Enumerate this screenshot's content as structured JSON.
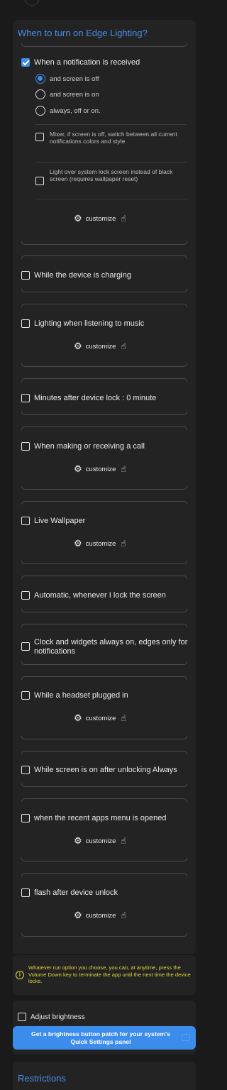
{
  "header": {
    "title": "When to turn on Edge Lighting?"
  },
  "notification": {
    "label": "When a notification is received",
    "checked": true,
    "options": [
      {
        "label": "and screen is off",
        "selected": true
      },
      {
        "label": "and screen is on",
        "selected": false
      },
      {
        "label": "always, off or on.",
        "selected": false
      }
    ],
    "mixer_label": "Mixer, if screen is off, switch between all current notifications colors and style",
    "lockscreen_label": "Light over system lock screen instead of black screen (requires wallpaper reset)",
    "customize_label": "customize"
  },
  "triggers": [
    {
      "label": "While the device is charging",
      "customize": ""
    },
    {
      "label": "Lighting when listening to music",
      "customize": "customize"
    },
    {
      "label": "Minutes after device lock : 0 minute",
      "customize": ""
    },
    {
      "label": "When making or receiving a call",
      "customize": "customize"
    },
    {
      "label": "Live Wallpaper",
      "customize": "customize"
    },
    {
      "label": "Automatic, whenever I lock the screen",
      "customize": ""
    },
    {
      "label": "Clock and widgets always on, edges only for notifications",
      "customize": ""
    },
    {
      "label": "While a headset plugged in",
      "customize": "customize"
    },
    {
      "label": "While screen is on after unlocking Always",
      "customize": ""
    },
    {
      "label": "when the recent apps menu is opened",
      "customize": "customize"
    },
    {
      "label": "flash after device unlock",
      "customize": "customize"
    }
  ],
  "info": {
    "text": "Whatever run option you choose, you can, at anytime, press the Volume Down key to terminate the app until the next time the device locks."
  },
  "brightness": {
    "label": "Adjust brightness",
    "button_label": "Get a brightness button patch for your system's Quick Settings panel"
  },
  "restrictions": {
    "title": "Restrictions"
  },
  "colors": {
    "accent": "#3d8eea",
    "info_text": "#e4d43c",
    "panel": "#232323",
    "background": "#1a1a1a"
  }
}
